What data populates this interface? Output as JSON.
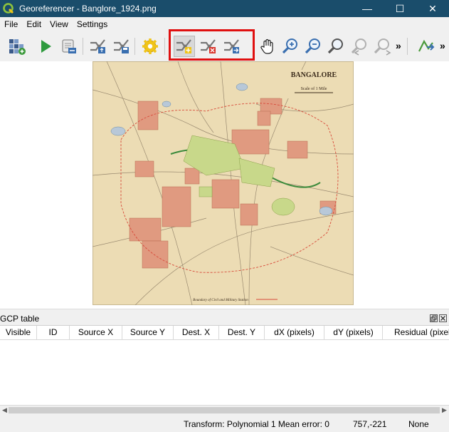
{
  "window": {
    "title": "Georeferencer - Banglore_1924.png",
    "minimize": "—",
    "maximize": "☐",
    "close": "✕"
  },
  "menu": [
    "File",
    "Edit",
    "View",
    "Settings"
  ],
  "toolbar": {
    "icons": [
      "open-raster-icon",
      "start-georeferencing-icon",
      "generate-gdal-script-icon",
      "load-gcp-points-icon",
      "save-gcp-points-icon",
      "transformation-settings-icon",
      "add-point-icon",
      "delete-point-icon",
      "move-gcp-point-icon",
      "pan-icon",
      "zoom-in-icon",
      "zoom-out-icon",
      "zoom-to-layer-icon",
      "zoom-last-icon",
      "zoom-next-icon",
      "link-georeferencer-icon"
    ],
    "overflow": "»"
  },
  "map": {
    "title": "BANGALORE",
    "scale": "Scale of 1 Mile",
    "footer": "Boundary of Civil and Military Station"
  },
  "gcp": {
    "title": "GCP table",
    "columns": [
      "Visible",
      "ID",
      "Source X",
      "Source Y",
      "Dest. X",
      "Dest. Y",
      "dX (pixels)",
      "dY (pixels)",
      "Residual (pixels)"
    ]
  },
  "status": {
    "transform": "Transform: Polynomial 1 Mean error: 0",
    "coords": "757,-221",
    "crs": "None"
  },
  "colors": {
    "titlebar": "#1a4d6b",
    "highlight": "#e01010"
  }
}
